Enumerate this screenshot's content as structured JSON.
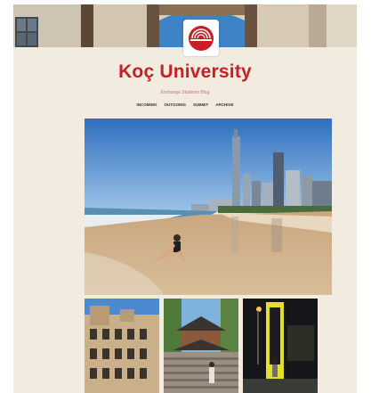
{
  "header": {
    "title": "Koç University",
    "subtitle": "Exchange Students Blog"
  },
  "nav": {
    "items": [
      {
        "label": "INCOMING"
      },
      {
        "label": "OUTGOING"
      },
      {
        "label": "SUBMIT"
      },
      {
        "label": "ARCHIVE"
      }
    ]
  },
  "icons": {
    "logo": "shell-logo-icon"
  },
  "colors": {
    "brand_red": "#c81f26",
    "page_background": "#f1ebe0"
  },
  "posts": {
    "featured_scene": "beach-skyline-photo",
    "thumbnails": [
      "historic-building-photo",
      "pagoda-photo",
      "night-sign-photo"
    ]
  }
}
